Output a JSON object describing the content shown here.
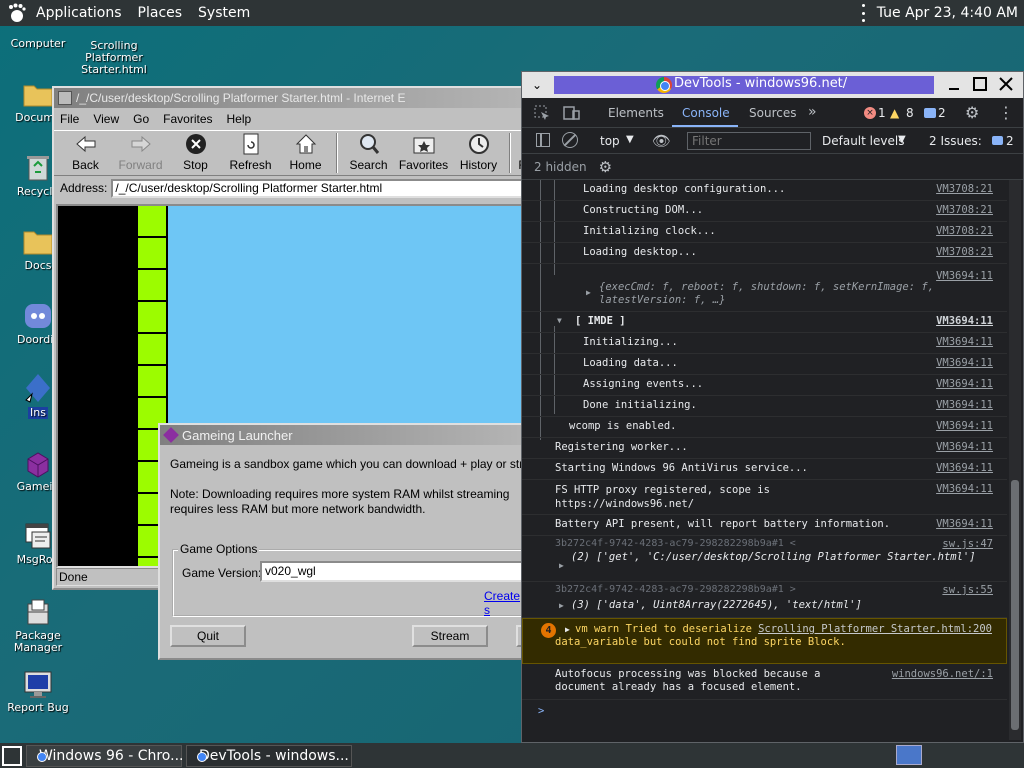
{
  "top_panel": {
    "applications": "Applications",
    "places": "Places",
    "system": "System",
    "clock": "Tue Apr 23,  4:40 AM"
  },
  "desktop": {
    "icons": [
      {
        "label": "Computer"
      },
      {
        "label": "Scrolling Platformer Starter.html"
      },
      {
        "label": "Docume"
      },
      {
        "label": "Recycle"
      },
      {
        "label": "Docs"
      },
      {
        "label": "Doordis"
      },
      {
        "label": "Ins"
      },
      {
        "label": "Gamein"
      },
      {
        "label": "MsgRoo"
      },
      {
        "label": "Package Manager"
      },
      {
        "label": "Report Bug"
      }
    ]
  },
  "ie": {
    "title": "/_/C/user/desktop/Scrolling Platformer Starter.html - Internet E",
    "menu": [
      "File",
      "View",
      "Go",
      "Favorites",
      "Help"
    ],
    "toolbar": {
      "back": "Back",
      "forward": "Forward",
      "stop": "Stop",
      "refresh": "Refresh",
      "home": "Home",
      "search": "Search",
      "favorites": "Favorites",
      "history": "History",
      "more": "F"
    },
    "address_label": "Address:",
    "address_value": "/_/C/user/desktop/Scrolling Platformer Starter.html",
    "status": "Done"
  },
  "launcher": {
    "title": "Gameing Launcher",
    "intro": "Gameing is a sandbox game which you can download + play or stream.",
    "note": "Note: Downloading requires more system RAM whilst streaming requires less RAM but more network bandwidth.",
    "group_label": "Game Options",
    "version_label": "Game Version:",
    "version_value": "v020_wgl",
    "create_link": "Create s",
    "quit": "Quit",
    "stream": "Stream",
    "third": "D"
  },
  "devtools": {
    "title": "DevTools - windows96.net/",
    "tabs": {
      "elements": "Elements",
      "console": "Console",
      "sources": "Sources"
    },
    "counts": {
      "errors": "1",
      "warnings": "8",
      "info": "2"
    },
    "filter": {
      "context": "top",
      "placeholder": "Filter",
      "levels": "Default levels",
      "issues_label": "2 Issues:",
      "issues_count": "2"
    },
    "hidden": "2 hidden",
    "console": [
      {
        "msg": "Loading desktop configuration...",
        "src": "VM3708:21"
      },
      {
        "msg": "Constructing DOM...",
        "src": "VM3708:21"
      },
      {
        "msg": "Initializing clock...",
        "src": "VM3708:21"
      },
      {
        "msg": "Loading desktop...",
        "src": "VM3708:21"
      },
      {
        "msg": "{execCmd: f, reboot: f, shutdown: f, setKernImage: f, latestVersion: f, …}",
        "src": "VM3694:11"
      },
      {
        "msg": "[ IMDE ]",
        "src": "VM3694:11"
      },
      {
        "msg": "Initializing...",
        "src": "VM3694:11"
      },
      {
        "msg": "Loading data...",
        "src": "VM3694:11"
      },
      {
        "msg": "Assigning events...",
        "src": "VM3694:11"
      },
      {
        "msg": "Done initializing.",
        "src": "VM3694:11"
      },
      {
        "msg": "wcomp is enabled.",
        "src": "VM3694:11"
      },
      {
        "msg": "Registering worker...",
        "src": "VM3694:11"
      },
      {
        "msg": "Starting Windows 96 AntiVirus service...",
        "src": "VM3694:11"
      },
      {
        "msg": "FS HTTP proxy registered, scope is https://windows96.net/",
        "src": "VM3694:11"
      },
      {
        "msg": "Battery API present, will report battery information.",
        "src": "VM3694:11"
      },
      {
        "msg": "3b272c4f-9742-4283-ac79-298282298b9a#1 <",
        "src": "sw.js:47"
      },
      {
        "msg": "(2) ['get', 'C:/user/desktop/Scrolling Platformer Starter.html']",
        "src": ""
      },
      {
        "msg": "3b272c4f-9742-4283-ac79-298282298b9a#1 >",
        "src": "sw.js:55"
      },
      {
        "msg": "(3) ['data', Uint8Array(2272645), 'text/html']",
        "src": ""
      },
      {
        "msg": "vm warn Tried to deserialize sprite specific monitor data_variable but could not find sprite Block.",
        "src": "Scrolling Platformer Starter.html:200",
        "count": "4"
      },
      {
        "msg": "Autofocus processing was blocked because a document already has a focused element.",
        "src": "windows96.net/:1"
      }
    ],
    "prompt": ">"
  },
  "taskbar": {
    "tasks": [
      {
        "label": "Windows 96 - Chro..."
      },
      {
        "label": "DevTools - windows..."
      }
    ]
  },
  "colors": {
    "desktop": "#16626f",
    "panel": "#2e3436",
    "devtools_bg": "#202124",
    "accent": "#8ab4f8",
    "warn_bg": "#332b00",
    "lime": "#9cfc00",
    "sky": "#6ec6f5"
  }
}
